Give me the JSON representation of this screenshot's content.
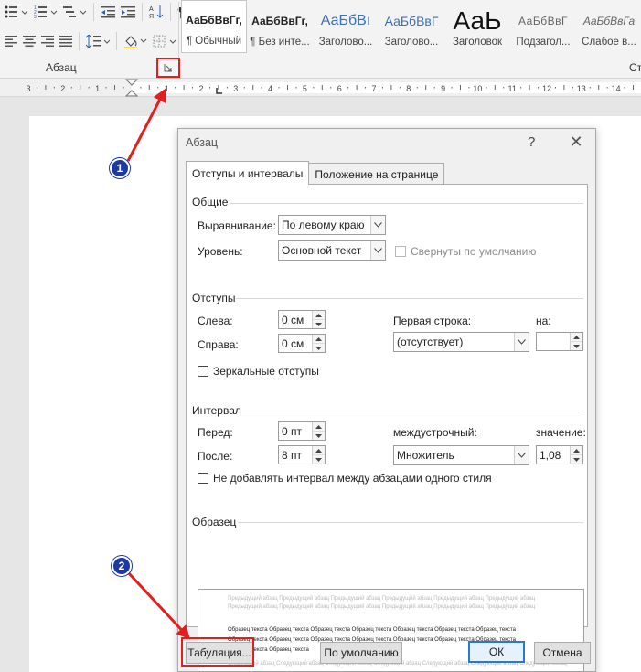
{
  "ribbon": {
    "group_label": "Абзац",
    "group_label_right": "Ст",
    "styles": [
      {
        "sample": "АаБбВвГг,",
        "name": "¶ Обычный",
        "kind": "normal",
        "selected": true
      },
      {
        "sample": "АаБбВвГг,",
        "name": "¶ Без инте...",
        "kind": "normal",
        "selected": false
      },
      {
        "sample": "АаБбВı",
        "name": "Заголово...",
        "kind": "h1",
        "selected": false
      },
      {
        "sample": "АаБбВвГ",
        "name": "Заголово...",
        "kind": "h2",
        "selected": false
      },
      {
        "sample": "АаЬ",
        "name": "Заголовок",
        "kind": "title",
        "selected": false
      },
      {
        "sample": "АаБбВвГ",
        "name": "Подзагол...",
        "kind": "sub",
        "selected": false
      },
      {
        "sample": "АаБбВвГа",
        "name": "Слабое в...",
        "kind": "em",
        "selected": false
      }
    ],
    "icons": {
      "row1": [
        "bullet-list-icon",
        "numbered-list-icon",
        "multilevel-list-icon",
        "decrease-indent-icon",
        "increase-indent-icon",
        "sort-icon",
        "show-marks-icon"
      ],
      "row2": [
        "align-left-icon",
        "align-center-icon",
        "align-right-icon",
        "justify-icon",
        "line-spacing-icon",
        "shading-icon",
        "borders-icon"
      ],
      "launcher": "dialog-launcher-icon"
    }
  },
  "ruler": {
    "labels": [
      "3",
      "2",
      "1",
      "1",
      "2",
      "3",
      "4",
      "5",
      "6",
      "7",
      "8",
      "9",
      "10",
      "11",
      "12",
      "13",
      "14"
    ]
  },
  "dialog": {
    "title": "Абзац",
    "help": "?",
    "close": "✕",
    "tabs": {
      "active": "Отступы и интервалы",
      "inactive": "Положение на странице"
    },
    "general": {
      "header": "Общие",
      "alignment_label": "Выравнивание:",
      "alignment_value": "По левому краю",
      "level_label": "Уровень:",
      "level_value": "Основной текст",
      "collapsed_label": "Свернуты по умолчанию"
    },
    "indents": {
      "header": "Отступы",
      "left_label": "Слева:",
      "left_value": "0 см",
      "right_label": "Справа:",
      "right_value": "0 см",
      "first_line_label": "Первая строка:",
      "first_line_value": "(отсутствует)",
      "by_label": "на:",
      "by_value": "",
      "mirror_label": "Зеркальные отступы"
    },
    "spacing": {
      "header": "Интервал",
      "before_label": "Перед:",
      "before_value": "0 пт",
      "after_label": "После:",
      "after_value": "8 пт",
      "line_label": "междустрочный:",
      "line_value": "Множитель",
      "at_label": "значение:",
      "at_value": "1,08",
      "no_space_label": "Не добавлять интервал между абзацами одного стиля"
    },
    "preview": {
      "header": "Образец",
      "prev_lines": [
        "Предыдущий абзац Предыдущий абзац Предыдущий абзац Предыдущий абзац Предыдущий абзац Предыдущий абзац",
        "Предыдущий абзац Предыдущий абзац Предыдущий абзац Предыдущий абзац Предыдущий абзац Предыдущий абзац"
      ],
      "sample_lines": [
        "Образец текста Образец текста Образец текста Образец текста Образец текста Образец текста Образец текста",
        "Образец текста Образец текста Образец текста Образец текста Образец текста Образец текста Образец текста",
        "Образец текста Образец текста"
      ],
      "next_lines": [
        "Следующий абзац Следующий абзац Следующий абзац Следующий абзац Следующий абзац Следующий абзац Следующий абзац"
      ]
    },
    "buttons": {
      "tabs": "Табуляция...",
      "default": "По умолчанию",
      "ok": "ОК",
      "cancel": "Отмена"
    }
  },
  "annotations": {
    "badge_1": "1",
    "badge_2": "2",
    "highlight_color": "#e02020",
    "badge_color": "#1e3aa0"
  }
}
